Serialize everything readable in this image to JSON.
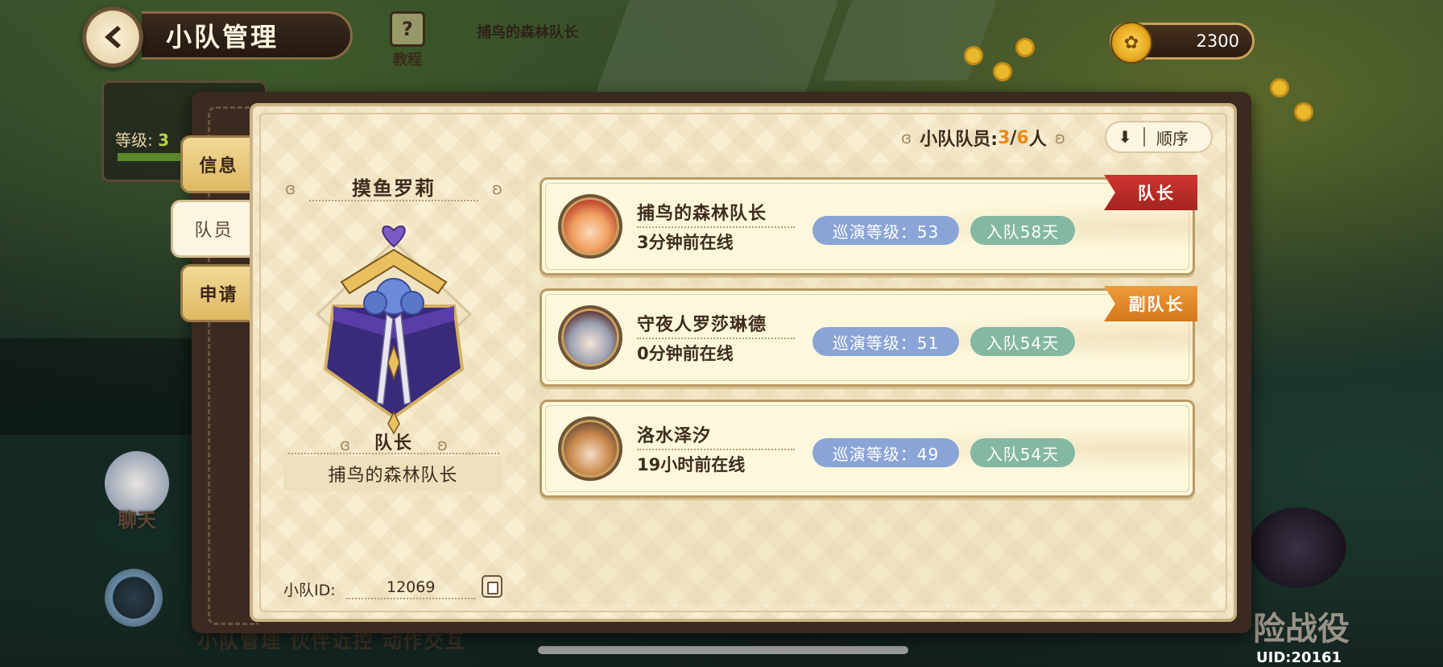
{
  "header": {
    "title": "小队管理",
    "tutorial_label": "教程",
    "bg_player_name": "捕鸟的森林队长",
    "coins": "2300"
  },
  "background": {
    "level_label": "等级:",
    "level_value": "3",
    "chat_label": "聊天",
    "bottom_tabs": "小队管理   伙伴近控   动作交互",
    "battle_label": "险战役",
    "uid": "UID:20161"
  },
  "side_tabs": [
    {
      "label": "信息",
      "active": false
    },
    {
      "label": "队员",
      "active": true
    },
    {
      "label": "申请",
      "active": false
    }
  ],
  "squad": {
    "name": "摸鱼罗莉",
    "leader_title": "队长",
    "leader_name": "捕鸟的森林队长",
    "id_label": "小队ID:",
    "id_value": "12069"
  },
  "members_header": {
    "label": "小队队员:",
    "current": "3",
    "slash": "/",
    "max": "6",
    "unit": "人",
    "sort_label": "顺序",
    "sort_icon": "arrow-down-icon"
  },
  "members": [
    {
      "name": "捕鸟的森林队长",
      "status": "3分钟前在线",
      "level": "巡演等级：53",
      "joined": "入队58天",
      "role": "队长",
      "role_color": "#c42e28"
    },
    {
      "name": "守夜人罗莎琳德",
      "status": "0分钟前在线",
      "level": "巡演等级：51",
      "joined": "入队54天",
      "role": "副队长",
      "role_color": "#e2882c"
    },
    {
      "name": "洛水泽汐",
      "status": "19小时前在线",
      "level": "巡演等级：49",
      "joined": "入队54天",
      "role": "",
      "role_color": ""
    }
  ],
  "colors": {
    "accent_orange": "#e88a1a",
    "level_pill": "#8aa4d6",
    "days_pill": "#84b8a2",
    "panel_bg": "#f8eed2"
  }
}
